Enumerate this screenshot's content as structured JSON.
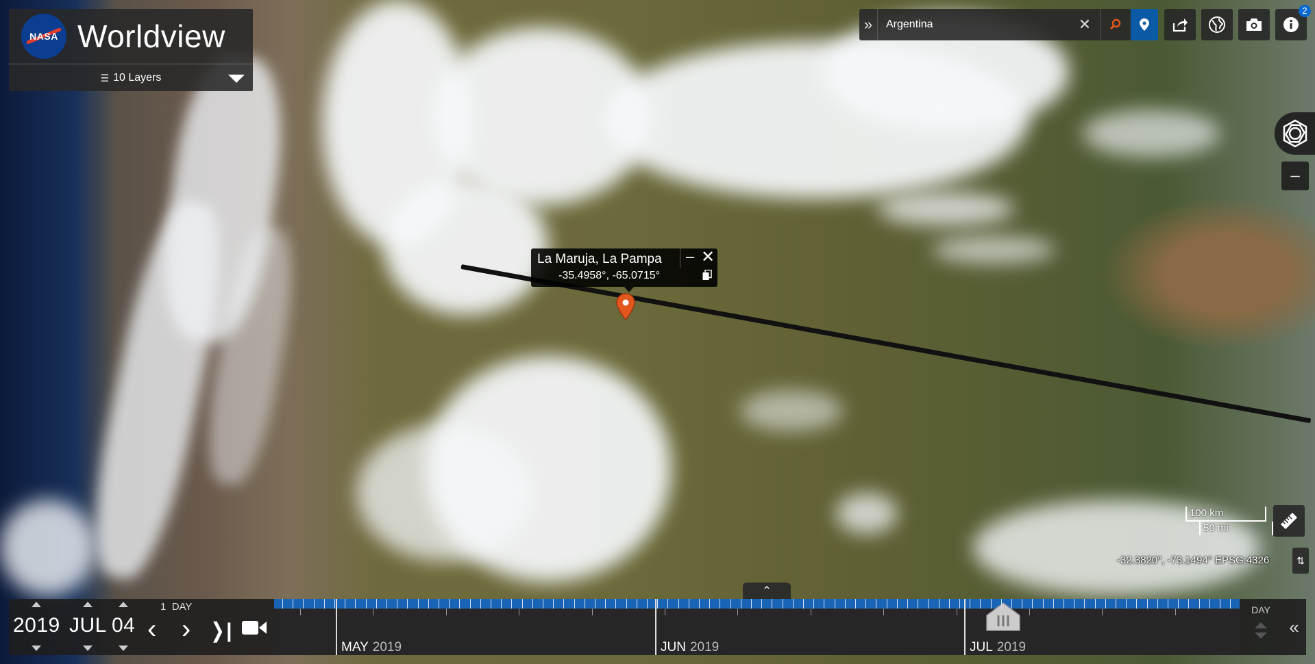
{
  "app": {
    "title": "Worldview",
    "logo_text": "NASA"
  },
  "layers": {
    "label": "10 Layers"
  },
  "search": {
    "value": "Argentina",
    "placeholder": ""
  },
  "info": {
    "badge_count": "2"
  },
  "popup": {
    "title": "La Maruja, La Pampa",
    "coords": "-35.4958°, -65.0715°"
  },
  "scale": {
    "km": "100 km",
    "mi": "50 mi"
  },
  "cursor": {
    "coords": "-32.3820°, -73.1494°",
    "projection": "EPSG:4326"
  },
  "date": {
    "year": "2019",
    "month": "JUL",
    "day": "04",
    "interval_value": "1",
    "interval_unit": "DAY"
  },
  "timeline": {
    "zoom_level": "DAY",
    "months": [
      {
        "name": "MAY",
        "year": "2019"
      },
      {
        "name": "JUN",
        "year": "2019"
      },
      {
        "name": "JUL",
        "year": "2019"
      }
    ]
  },
  "icons": [
    "nasa-logo",
    "layers-icon",
    "chevron-icon",
    "close-icon",
    "search-icon",
    "pin-icon",
    "share-icon",
    "globe-icon",
    "camera-icon",
    "info-icon",
    "hexagon-logo-icon",
    "minus-icon",
    "ruler-icon",
    "swap-icon",
    "video-icon"
  ],
  "colors": {
    "accent": "#0a5aa6",
    "marker": "#e2571e",
    "timeline_band": "#1a64b8"
  }
}
